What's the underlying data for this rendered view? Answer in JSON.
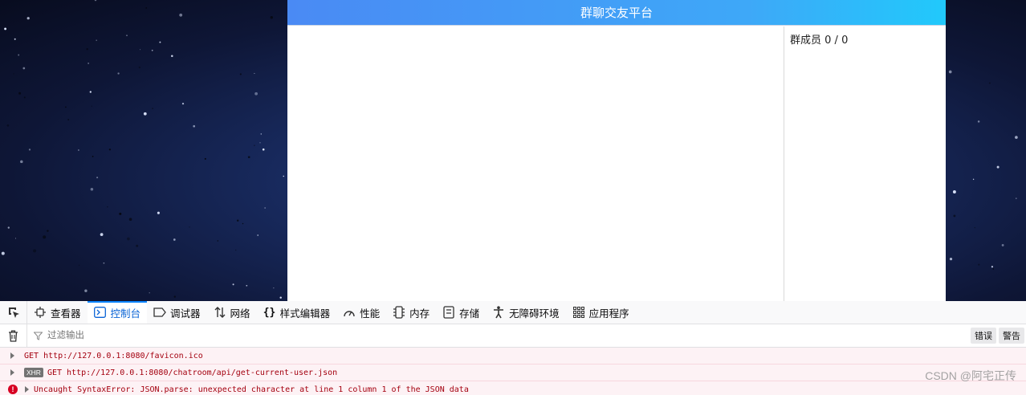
{
  "app": {
    "title": "群聊交友平台",
    "members_label": "群成员",
    "members_count": " 0 / 0"
  },
  "devtools": {
    "tabs": [
      {
        "label": "查看器",
        "icon": "inspector-icon"
      },
      {
        "label": "控制台",
        "icon": "console-icon",
        "active": true
      },
      {
        "label": "调试器",
        "icon": "debugger-icon"
      },
      {
        "label": "网络",
        "icon": "network-icon"
      },
      {
        "label": "样式编辑器",
        "icon": "style-editor-icon"
      },
      {
        "label": "性能",
        "icon": "performance-icon"
      },
      {
        "label": "内存",
        "icon": "memory-icon"
      },
      {
        "label": "存储",
        "icon": "storage-icon"
      },
      {
        "label": "无障碍环境",
        "icon": "accessibility-icon"
      },
      {
        "label": "应用程序",
        "icon": "application-icon"
      }
    ],
    "filter_placeholder": "过滤输出",
    "filter_buttons": [
      "错误",
      "警告"
    ],
    "logs": [
      {
        "text": "GET http://127.0.0.1:8080/favicon.ico"
      },
      {
        "badge": "XHR",
        "text": "GET http://127.0.0.1:8080/chatroom/api/get-current-user.json"
      },
      {
        "text": "Uncaught SyntaxError: JSON.parse: unexpected character at line 1 column 1 of the JSON data"
      }
    ]
  },
  "watermark": "CSDN @阿宅正传",
  "colors": {
    "header_start": "#4a8af4",
    "header_end": "#21c9fb",
    "active_tab": "#0a64d6",
    "error_text": "#a4000f"
  }
}
